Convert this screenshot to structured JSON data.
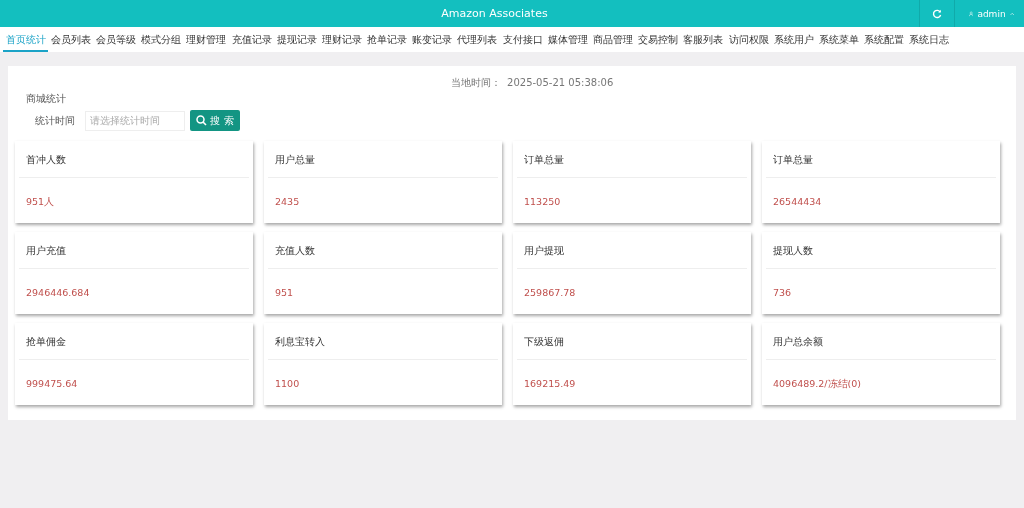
{
  "header": {
    "title": "Amazon Associates",
    "user": "admin"
  },
  "nav": [
    {
      "label": "首页统计",
      "selected": true
    },
    {
      "label": "会员列表",
      "selected": false
    },
    {
      "label": "会员等级",
      "selected": false
    },
    {
      "label": "模式分组",
      "selected": false
    },
    {
      "label": "理财管理",
      "selected": false
    },
    {
      "label": "充值记录",
      "selected": false
    },
    {
      "label": "提现记录",
      "selected": false
    },
    {
      "label": "理财记录",
      "selected": false
    },
    {
      "label": "抢单记录",
      "selected": false
    },
    {
      "label": "账变记录",
      "selected": false
    },
    {
      "label": "代理列表",
      "selected": false
    },
    {
      "label": "支付接口",
      "selected": false
    },
    {
      "label": "媒体管理",
      "selected": false
    },
    {
      "label": "商品管理",
      "selected": false
    },
    {
      "label": "交易控制",
      "selected": false
    },
    {
      "label": "客服列表",
      "selected": false
    },
    {
      "label": "访问权限",
      "selected": false
    },
    {
      "label": "系统用户",
      "selected": false
    },
    {
      "label": "系统菜单",
      "selected": false
    },
    {
      "label": "系统配置",
      "selected": false
    },
    {
      "label": "系统日志",
      "selected": false
    }
  ],
  "local_time": {
    "label": "当地时间：",
    "value": "2025-05-21 05:38:06"
  },
  "section_title": "商城统计",
  "filter": {
    "label": "统计时间",
    "placeholder": "请选择统计时间",
    "button": "搜 索"
  },
  "stats": [
    {
      "title": "首冲人数",
      "value": "951人"
    },
    {
      "title": "用户总量",
      "value": "2435"
    },
    {
      "title": "订单总量",
      "value": "113250"
    },
    {
      "title": "订单总量",
      "value": "26544434"
    },
    {
      "title": "用户充值",
      "value": "2946446.684"
    },
    {
      "title": "充值人数",
      "value": "951"
    },
    {
      "title": "用户提现",
      "value": "259867.78"
    },
    {
      "title": "提现人数",
      "value": "736"
    },
    {
      "title": "抢单佣金",
      "value": "999475.64"
    },
    {
      "title": "利息宝转入",
      "value": "1100"
    },
    {
      "title": "下级返佣",
      "value": "169215.49"
    },
    {
      "title": "用户总余额",
      "value": "4096489.2/冻结(0)"
    }
  ]
}
